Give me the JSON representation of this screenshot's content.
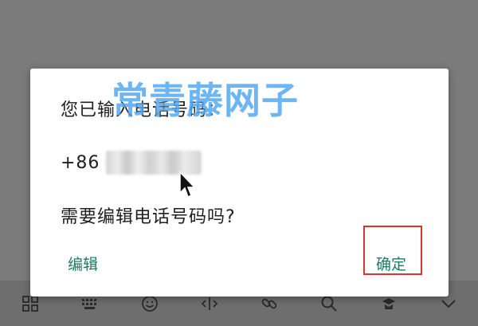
{
  "dialog": {
    "title": "您已输入电话号码：",
    "phone_prefix": "+86",
    "question": "需要编辑电话号码吗?",
    "edit_button": "编辑",
    "ok_button": "确定"
  },
  "watermark": "常青藤网子",
  "toolbar": {
    "icons": [
      "grid-icon",
      "keyboard-icon",
      "emoji-icon",
      "text-cursor-icon",
      "link-icon",
      "search-icon",
      "clipboard-icon",
      "collapse-icon"
    ]
  },
  "colors": {
    "accent": "#1d7a66",
    "highlight": "#d9342f",
    "watermark": "#55aaf2",
    "scrim": "#7b7b7b"
  }
}
